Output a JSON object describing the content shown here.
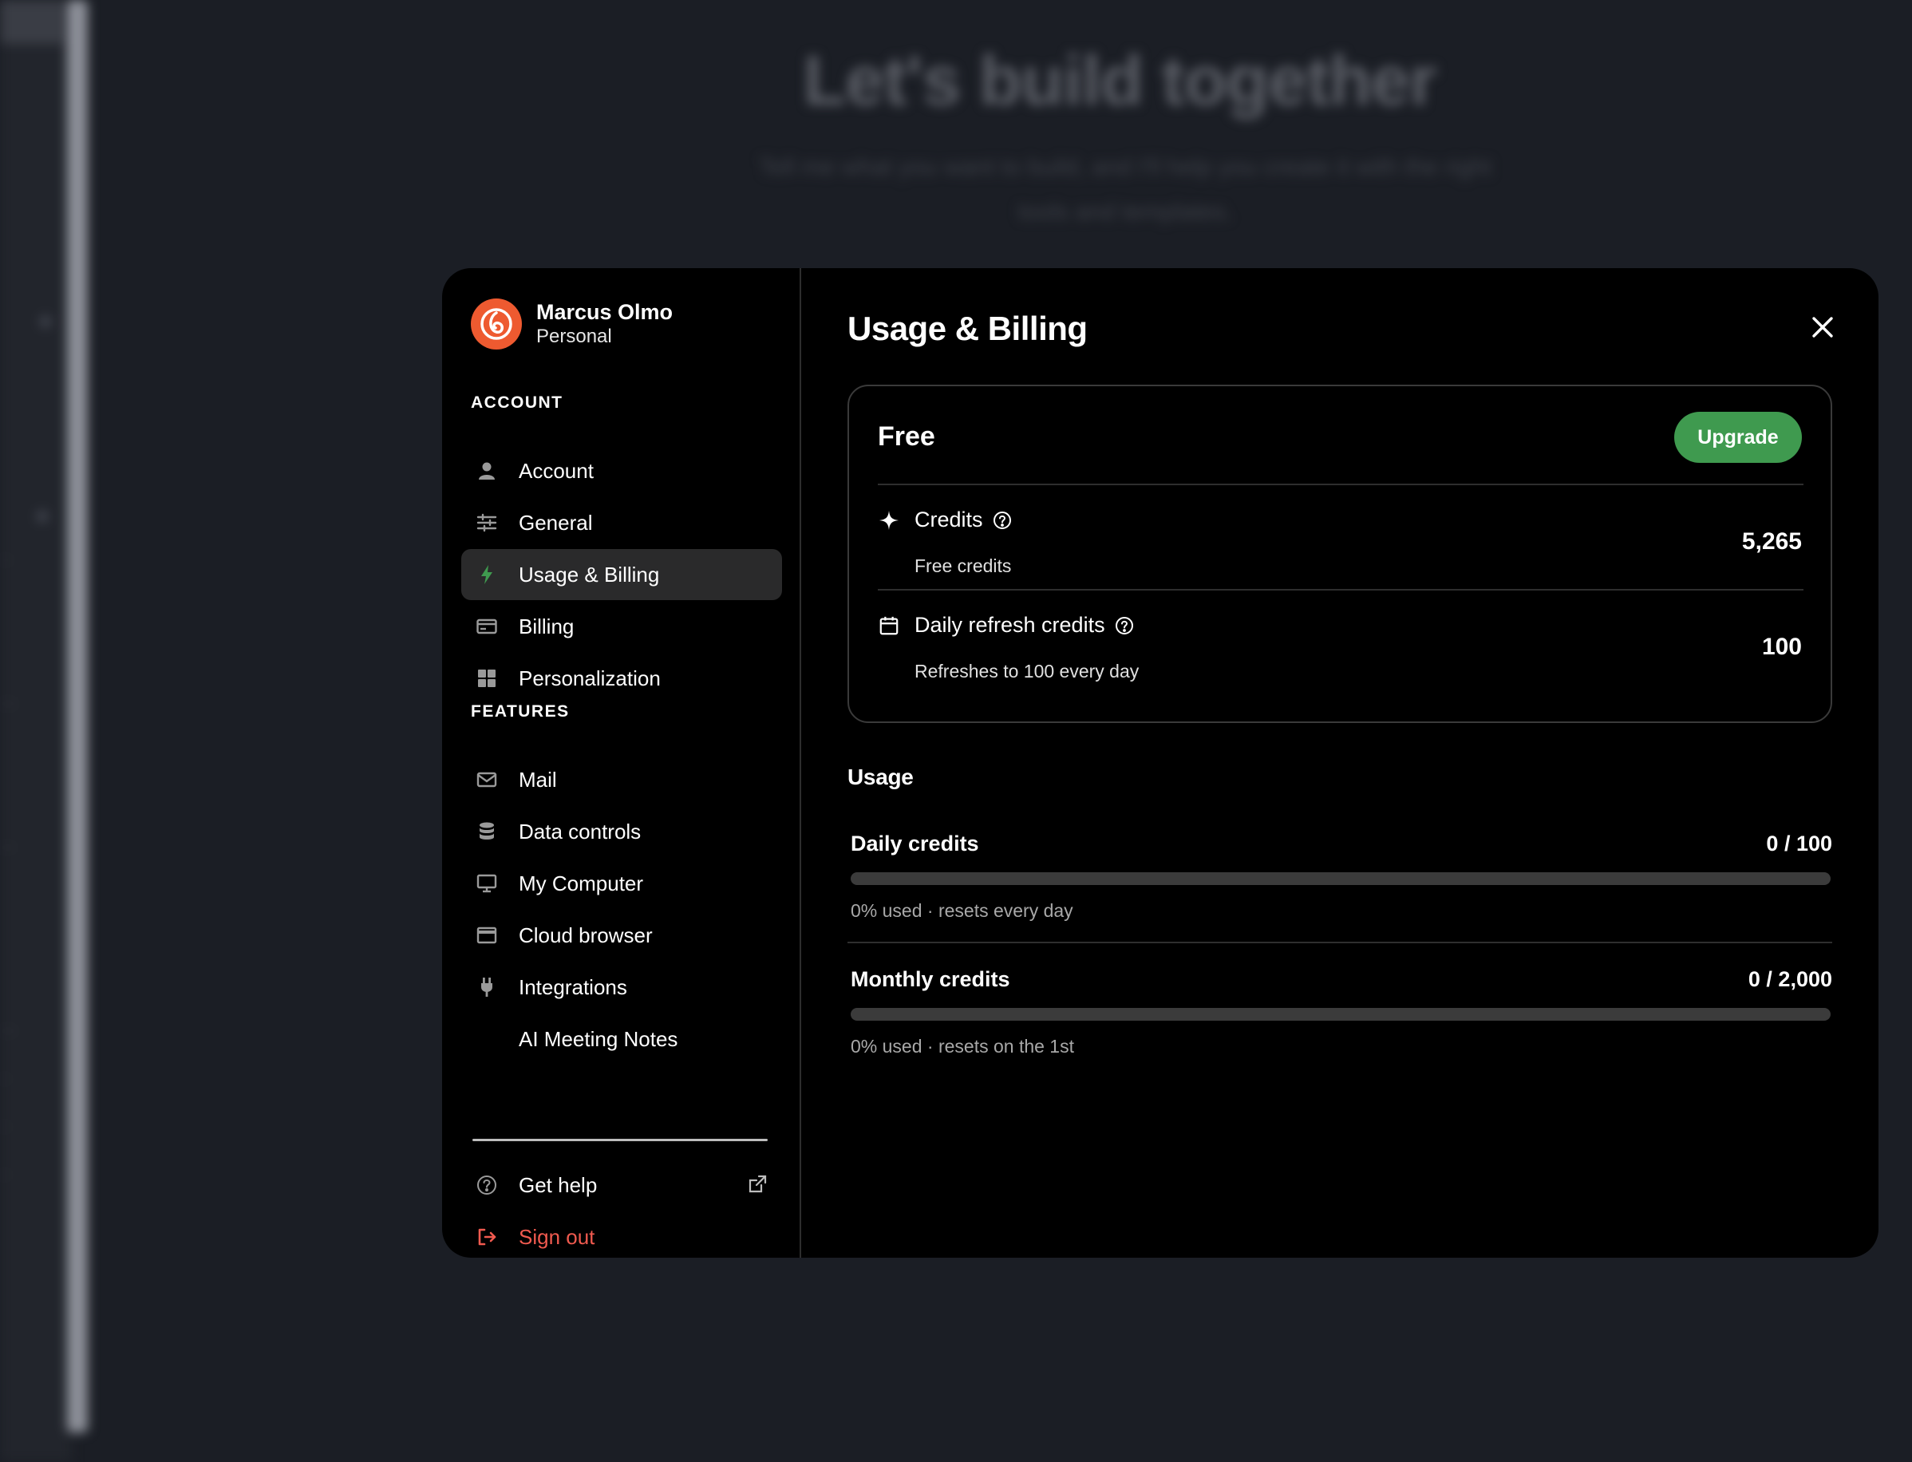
{
  "background": {
    "headline": "Let's build together",
    "subheadline": "Tell me what you want to build, and I'll help you create it with the right tools and templates."
  },
  "profile": {
    "name": "Marcus Olmo",
    "plan_type": "Personal"
  },
  "sidebar": {
    "account_section": "ACCOUNT",
    "account_items": [
      {
        "label": "Account",
        "icon": "user-icon"
      },
      {
        "label": "General",
        "icon": "sliders-icon"
      },
      {
        "label": "Usage & Billing",
        "icon": "bolt-icon",
        "active": true
      },
      {
        "label": "Billing",
        "icon": "credit-card-icon"
      },
      {
        "label": "Personalization",
        "icon": "grid-icon"
      }
    ],
    "features_section": "FEATURES",
    "feature_items": [
      {
        "label": "Mail",
        "icon": "mail-icon"
      },
      {
        "label": "Data controls",
        "icon": "database-icon"
      },
      {
        "label": "My Computer",
        "icon": "monitor-icon"
      },
      {
        "label": "Cloud browser",
        "icon": "browser-window-icon"
      },
      {
        "label": "Integrations",
        "icon": "plug-icon"
      },
      {
        "label": "AI Meeting Notes",
        "icon": ""
      }
    ],
    "get_help": "Get help",
    "sign_out": "Sign out"
  },
  "main": {
    "title": "Usage & Billing",
    "plan": {
      "name": "Free",
      "upgrade_label": "Upgrade",
      "credits_label": "Credits",
      "credits_sub": "Free credits",
      "credits_value": "5,265",
      "daily_label": "Daily refresh credits",
      "daily_sub": "Refreshes to 100 every day",
      "daily_value": "100"
    },
    "usage": {
      "title": "Usage",
      "meters": [
        {
          "label": "Daily credits",
          "value": "0 / 100",
          "used_fraction": 0,
          "note": "0% used · resets every day"
        },
        {
          "label": "Monthly credits",
          "value": "0 / 2,000",
          "used_fraction": 0,
          "note": "0% used · resets on the 1st"
        }
      ]
    }
  },
  "colors": {
    "accent_green": "#3f9a4f",
    "sign_out_red": "#f05a4f",
    "avatar_orange": "#ee5a30",
    "modal_bg": "#000000",
    "page_bg": "#1b1e25"
  }
}
